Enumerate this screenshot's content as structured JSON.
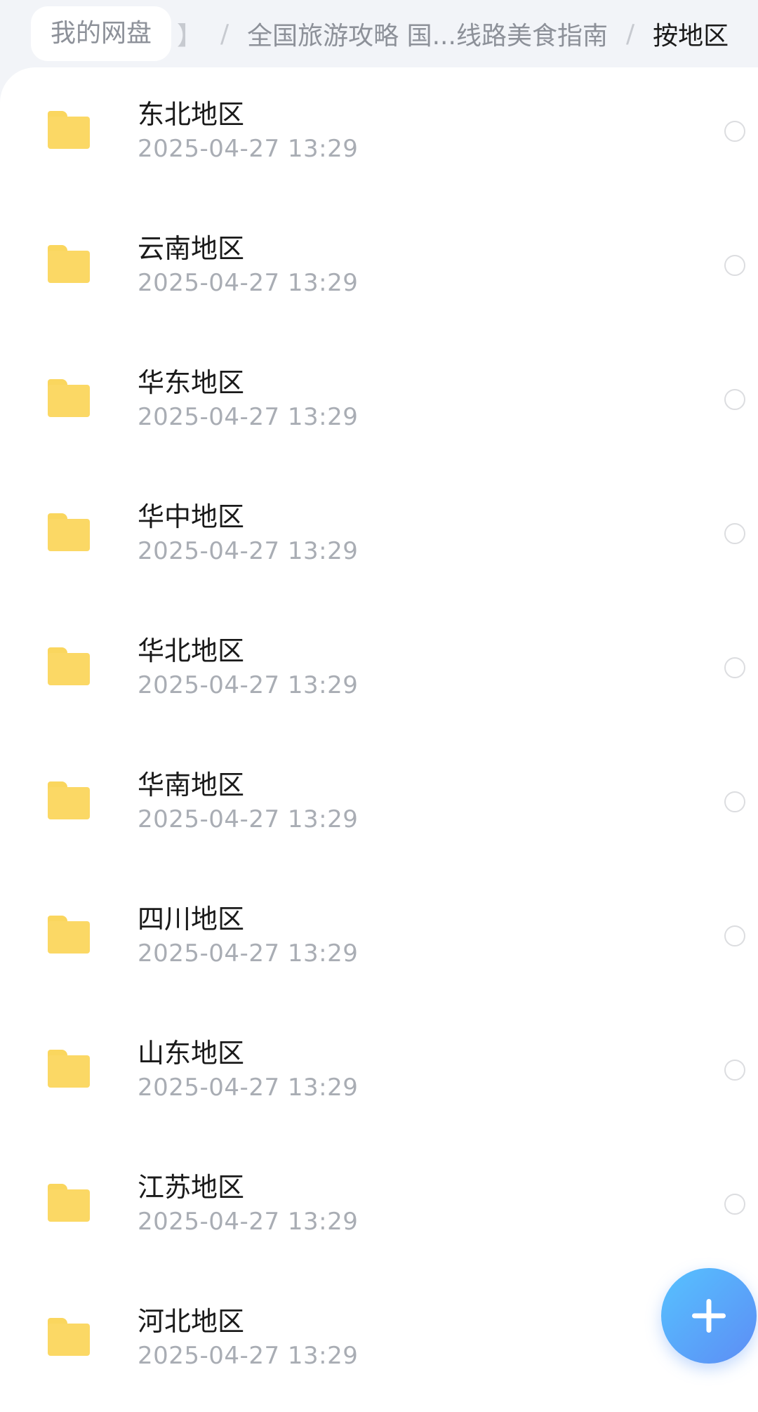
{
  "breadcrumb": {
    "root": "我的网盘",
    "faded": "】",
    "separator": "/",
    "middle": "全国旅游攻略 国...线路美食指南",
    "current": "按地区"
  },
  "icons": {
    "folder": "folder-icon",
    "select": "select-circle-icon",
    "add": "plus-icon"
  },
  "colors": {
    "folder": "#fbd865",
    "fab_start": "#56c2ff",
    "fab_end": "#5d8df5"
  },
  "folders": [
    {
      "name": "东北地区",
      "date": "2025-04-27  13:29"
    },
    {
      "name": "云南地区",
      "date": "2025-04-27  13:29"
    },
    {
      "name": "华东地区",
      "date": "2025-04-27  13:29"
    },
    {
      "name": "华中地区",
      "date": "2025-04-27  13:29"
    },
    {
      "name": "华北地区",
      "date": "2025-04-27  13:29"
    },
    {
      "name": "华南地区",
      "date": "2025-04-27  13:29"
    },
    {
      "name": "四川地区",
      "date": "2025-04-27  13:29"
    },
    {
      "name": "山东地区",
      "date": "2025-04-27  13:29"
    },
    {
      "name": "江苏地区",
      "date": "2025-04-27  13:29"
    },
    {
      "name": "河北地区",
      "date": "2025-04-27  13:29"
    }
  ]
}
